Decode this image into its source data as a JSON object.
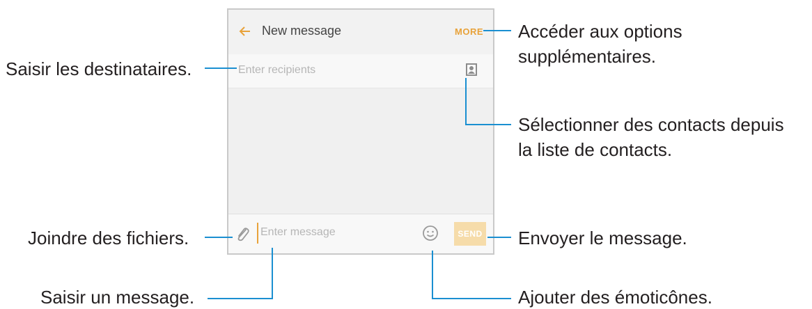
{
  "screen": {
    "back_icon": "arrow-left-icon",
    "title": "New message",
    "more_label": "MORE",
    "recipients_placeholder": "Enter recipients",
    "contact_icon": "contact-book-icon",
    "attach_icon": "paperclip-icon",
    "message_placeholder": "Enter message",
    "emoji_icon": "smiley-icon",
    "send_label": "SEND",
    "accent_color": "#e8a23a"
  },
  "callouts": {
    "recipients": "Saisir les destinataires.",
    "attach": "Joindre des fichiers.",
    "message": "Saisir un message.",
    "more_line1": "Accéder aux options",
    "more_line2": "supplémentaires.",
    "contacts_line1": "Sélectionner des contacts depuis",
    "contacts_line2": "la liste de contacts.",
    "send": "Envoyer le message.",
    "emoji": "Ajouter des émoticônes."
  },
  "leader_color": "#1a8fd1"
}
